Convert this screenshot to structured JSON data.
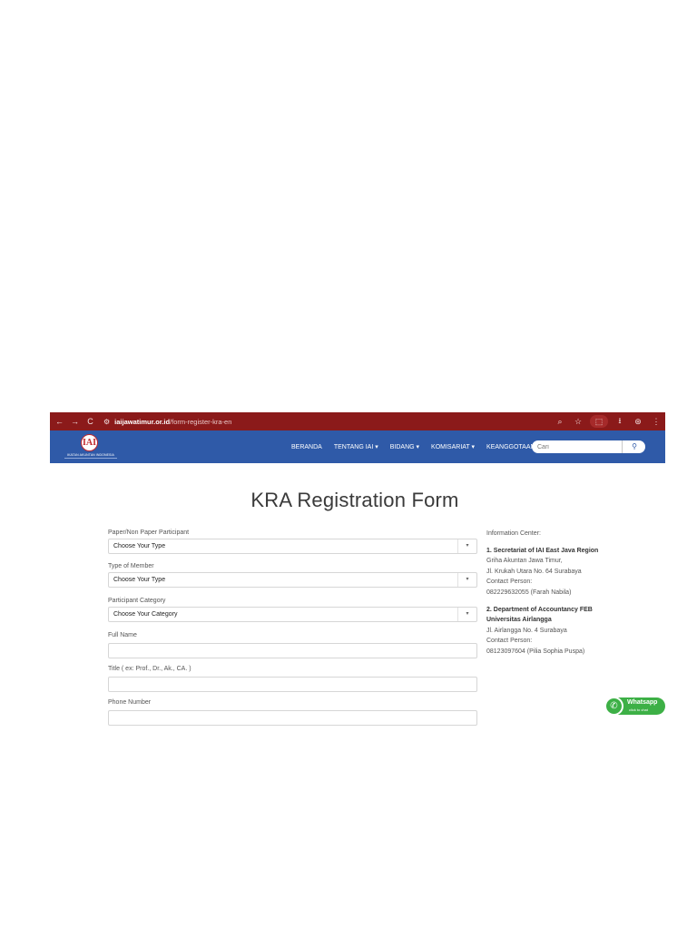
{
  "browser": {
    "url_domain": "iaijawatimur.or.id",
    "url_path": "/form-register-kra-en",
    "back_icon": "←",
    "forward_icon": "→",
    "reload_icon": "C",
    "site_icon": "⚙",
    "zoom_icon": "⌕",
    "star_icon": "☆",
    "ext_icon": "⬚",
    "download_icon": "⭳",
    "profile_icon": "⊛",
    "menu_icon": "⋮"
  },
  "site": {
    "logo_text": "IAI",
    "logo_org": "IKATAN AKUNTAN INDONESIA",
    "menu": [
      "BERANDA",
      "TENTANG IAI ▾",
      "BIDANG ▾",
      "KOMISARIAT ▾",
      "KEANGGOTAAN ▾"
    ],
    "search_placeholder": "Cari",
    "search_icon": "⚲"
  },
  "page": {
    "title": "KRA Registration Form"
  },
  "form": {
    "paper_label": "Paper/Non Paper Participant",
    "paper_value": "Choose Your Type",
    "member_label": "Type of Member",
    "member_value": "Choose Your Type",
    "category_label": "Participant Category",
    "category_value": "Choose Your Category",
    "name_label": "Full Name",
    "name_value": "",
    "title_label": "Title ( ex: Prof., Dr., Ak., CA. )",
    "title_value": "",
    "phone_label": "Phone Number",
    "phone_value": "",
    "caret": "▾"
  },
  "info": {
    "heading": "Information Center:",
    "s1_title": "1. Secretariat of IAI East Java Region",
    "s1_line1": "Griha Akuntan Jawa Timur,",
    "s1_line2": "Jl. Krukah Utara No. 64 Surabaya",
    "s1_contact_label": "Contact Person:",
    "s1_contact": "082229632055 (Farah Nabila)",
    "s2_title_a": "2. Department of Accountancy FEB",
    "s2_title_b": "Universitas Airlangga",
    "s2_line1": "Jl. Airlangga No. 4 Surabaya",
    "s2_contact_label": "Contact Person:",
    "s2_contact": "08123097604 (Pilia Sophia Puspa)"
  },
  "whatsapp": {
    "label": "Whatsapp",
    "sub": "click to chat",
    "icon": "✆"
  }
}
